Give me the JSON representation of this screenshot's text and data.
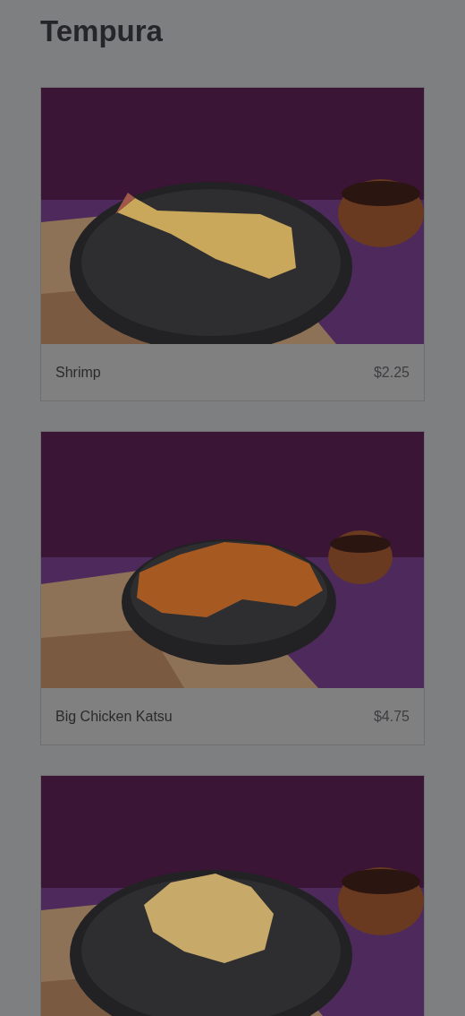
{
  "page": {
    "title": "Tempura"
  },
  "items": [
    {
      "image": {
        "kind": "picture"
      },
      "name": "Shrimp",
      "price": "$2.25"
    },
    {
      "image": {
        "kind": "picture"
      },
      "name": "Big Chicken Katsu",
      "price": "$4.75"
    },
    {
      "image": {
        "kind": "picture"
      }
    }
  ]
}
